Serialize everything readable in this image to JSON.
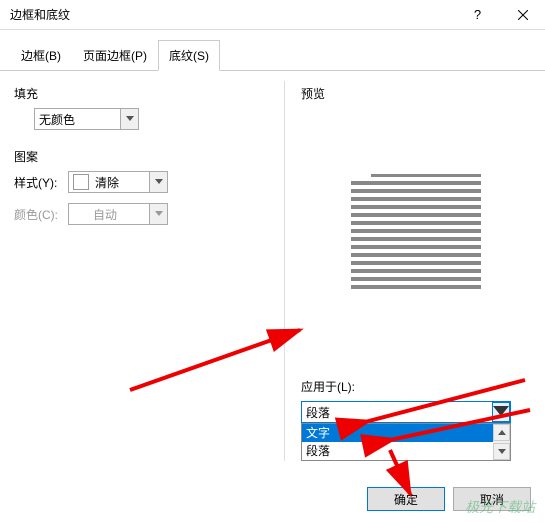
{
  "window": {
    "title": "边框和底纹",
    "help": "?",
    "close": "×"
  },
  "tabs": {
    "border": "边框(B)",
    "page_border": "页面边框(P)",
    "shading": "底纹(S)"
  },
  "fill": {
    "label": "填充",
    "value": "无颜色"
  },
  "pattern": {
    "label": "图案",
    "style_label": "样式(Y):",
    "style_value": "清除",
    "color_label": "颜色(C):",
    "color_value": "自动"
  },
  "preview": {
    "label": "预览"
  },
  "apply": {
    "label": "应用于(L):",
    "selected": "段落",
    "options": {
      "text": "文字",
      "para": "段落"
    }
  },
  "buttons": {
    "ok": "确定",
    "cancel": "取消"
  },
  "watermark": "极光下载站"
}
